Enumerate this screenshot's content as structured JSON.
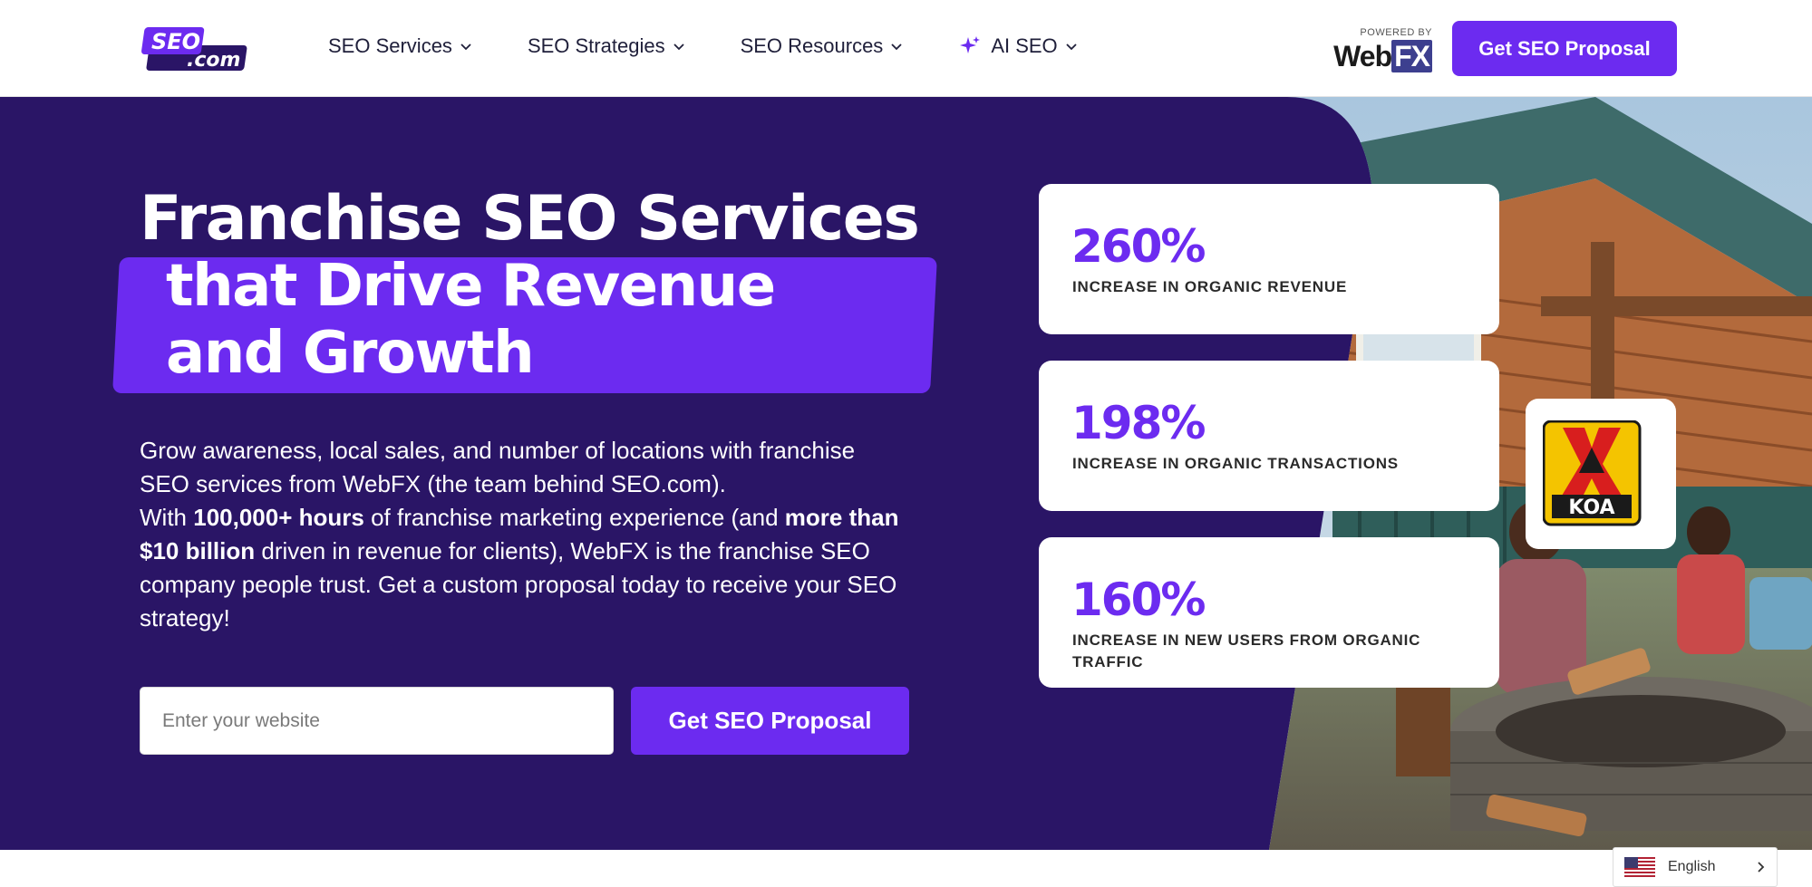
{
  "header": {
    "logo_text_top": "SEO",
    "logo_text_bottom": ".com",
    "nav": [
      {
        "label": "SEO Services"
      },
      {
        "label": "SEO Strategies"
      },
      {
        "label": "SEO Resources"
      },
      {
        "label": "AI SEO"
      }
    ],
    "powered_by": "POWERED BY",
    "powered_brand_a": "Web",
    "powered_brand_b": "FX",
    "cta_label": "Get SEO Proposal"
  },
  "hero": {
    "title_line1": "Franchise SEO Services",
    "title_line2": "that Drive Revenue and Growth",
    "desc_p1": "Grow awareness, local sales, and number of locations with franchise SEO services from WebFX (the team behind SEO.com).",
    "desc_p2_a": "With ",
    "desc_p2_b": "100,000+ hours",
    "desc_p2_c": " of franchise marketing experience (and ",
    "desc_p2_d": "more than $10 billion",
    "desc_p2_e": " driven in revenue for clients), WebFX is the franchise SEO company people trust. Get a custom proposal today to receive your SEO strategy!",
    "input_placeholder": "Enter your website",
    "cta_label": "Get SEO Proposal"
  },
  "stats": [
    {
      "value": "260%",
      "label": "INCREASE IN ORGANIC REVENUE"
    },
    {
      "value": "198%",
      "label": "INCREASE IN ORGANIC TRANSACTIONS"
    },
    {
      "value": "160%",
      "label": "INCREASE IN NEW USERS FROM ORGANIC TRAFFIC"
    }
  ],
  "client_logo": {
    "text": "KOA"
  },
  "language": {
    "label": "English"
  },
  "colors": {
    "brand": "#6c2bf0",
    "hero_bg": "#2a1566",
    "koa_yellow": "#f4c400",
    "koa_red": "#d81e1e"
  }
}
